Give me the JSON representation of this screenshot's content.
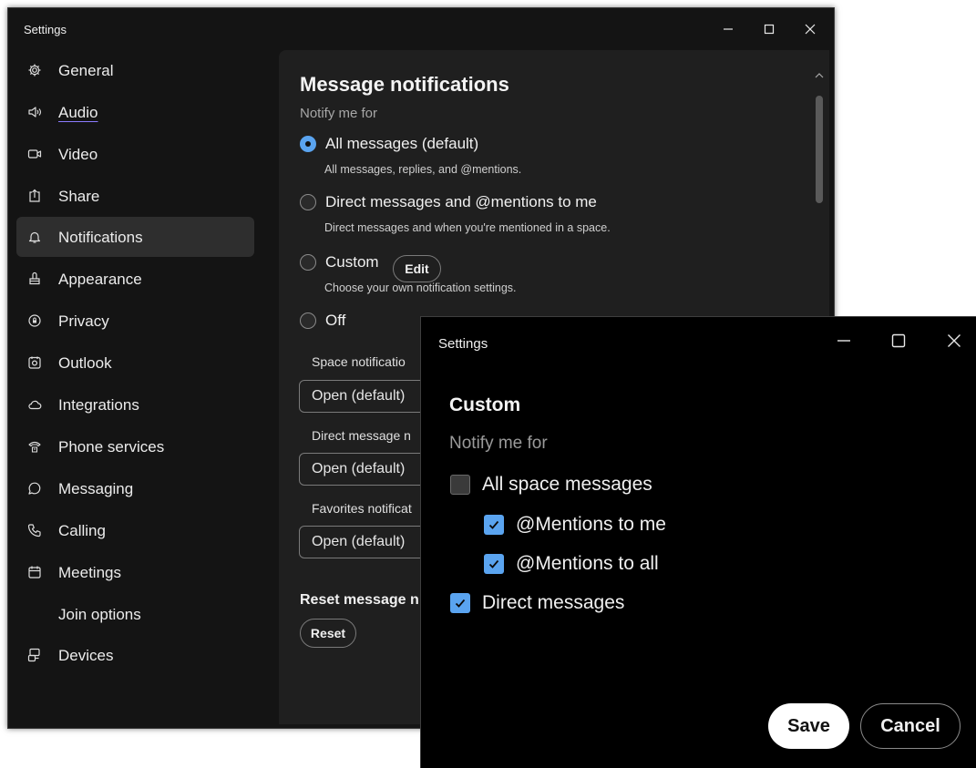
{
  "main_window": {
    "title": "Settings",
    "sidebar": [
      {
        "label": "General",
        "icon": "gear-icon"
      },
      {
        "label": "Audio",
        "icon": "speaker-icon"
      },
      {
        "label": "Video",
        "icon": "video-camera-icon"
      },
      {
        "label": "Share",
        "icon": "share-icon"
      },
      {
        "label": "Notifications",
        "icon": "bell-icon",
        "selected": true
      },
      {
        "label": "Appearance",
        "icon": "paint-bucket-icon"
      },
      {
        "label": "Privacy",
        "icon": "privacy-icon"
      },
      {
        "label": "Outlook",
        "icon": "outlook-icon"
      },
      {
        "label": "Integrations",
        "icon": "cloud-icon"
      },
      {
        "label": "Phone services",
        "icon": "phone-services-icon"
      },
      {
        "label": "Messaging",
        "icon": "chat-bubble-icon"
      },
      {
        "label": "Calling",
        "icon": "phone-icon"
      },
      {
        "label": "Meetings",
        "icon": "calendar-icon"
      },
      {
        "label": "Join options",
        "icon": ""
      },
      {
        "label": "Devices",
        "icon": "devices-icon"
      }
    ],
    "content": {
      "heading": "Message notifications",
      "notify_label": "Notify me for",
      "options": [
        {
          "label": "All messages (default)",
          "description": "All messages, replies, and @mentions.",
          "selected": true
        },
        {
          "label": "Direct messages and @mentions to me",
          "description": "Direct messages and when you're mentioned in a space.",
          "selected": false
        },
        {
          "label": "Custom",
          "description": "Choose your own notification settings.",
          "selected": false
        },
        {
          "label": "Off",
          "description": "",
          "selected": false
        }
      ],
      "edit_button": "Edit",
      "space_notifications_label": "Space notificatio",
      "space_notifications_value": "Open (default)",
      "direct_message_label": "Direct message n",
      "direct_message_value": "Open (default)",
      "favorites_label": "Favorites notificat",
      "favorites_value": "Open (default)",
      "reset_heading": "Reset message n",
      "reset_button": "Reset"
    }
  },
  "custom_window": {
    "title": "Settings",
    "heading": "Custom",
    "notify_label": "Notify me for",
    "checks": [
      {
        "label": "All space messages",
        "checked": false
      },
      {
        "label": "@Mentions to me",
        "checked": true
      },
      {
        "label": "@Mentions to all",
        "checked": true
      },
      {
        "label": "Direct messages",
        "checked": true
      }
    ],
    "save_button": "Save",
    "cancel_button": "Cancel"
  },
  "colors": {
    "accent": "#5aa4f0",
    "window_bg": "#141414",
    "panel_bg": "#1f1f1f",
    "dialog_bg": "#000000"
  }
}
